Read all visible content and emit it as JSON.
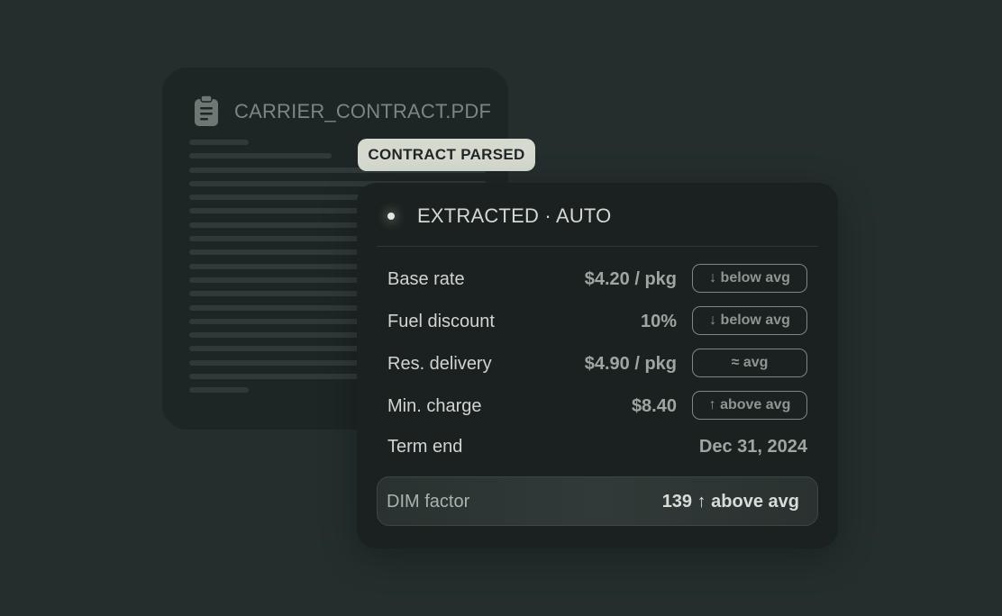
{
  "document": {
    "filename": "CARRIER_CONTRACT.PDF",
    "icon": "clipboard-document-icon"
  },
  "tag": {
    "label": "CONTRACT PARSED"
  },
  "card": {
    "header": "EXTRACTED · AUTO",
    "rows": [
      {
        "label": "Base rate",
        "value": "$4.20 / pkg",
        "badge": "↓ below avg"
      },
      {
        "label": "Fuel discount",
        "value": "10%",
        "badge": "↓ below avg"
      },
      {
        "label": "Res. delivery",
        "value": "$4.90 / pkg",
        "badge": "≈ avg"
      },
      {
        "label": "Min. charge",
        "value": "$8.40",
        "badge": "↑ above avg"
      },
      {
        "label": "Term end",
        "value": "Dec 31, 2024"
      }
    ],
    "dim": {
      "label": "DIM factor",
      "value": "139 ↑ above avg"
    }
  },
  "colors": {
    "background": "#232e2d",
    "card": "#1a2120",
    "tag": "#d5d9ce"
  }
}
